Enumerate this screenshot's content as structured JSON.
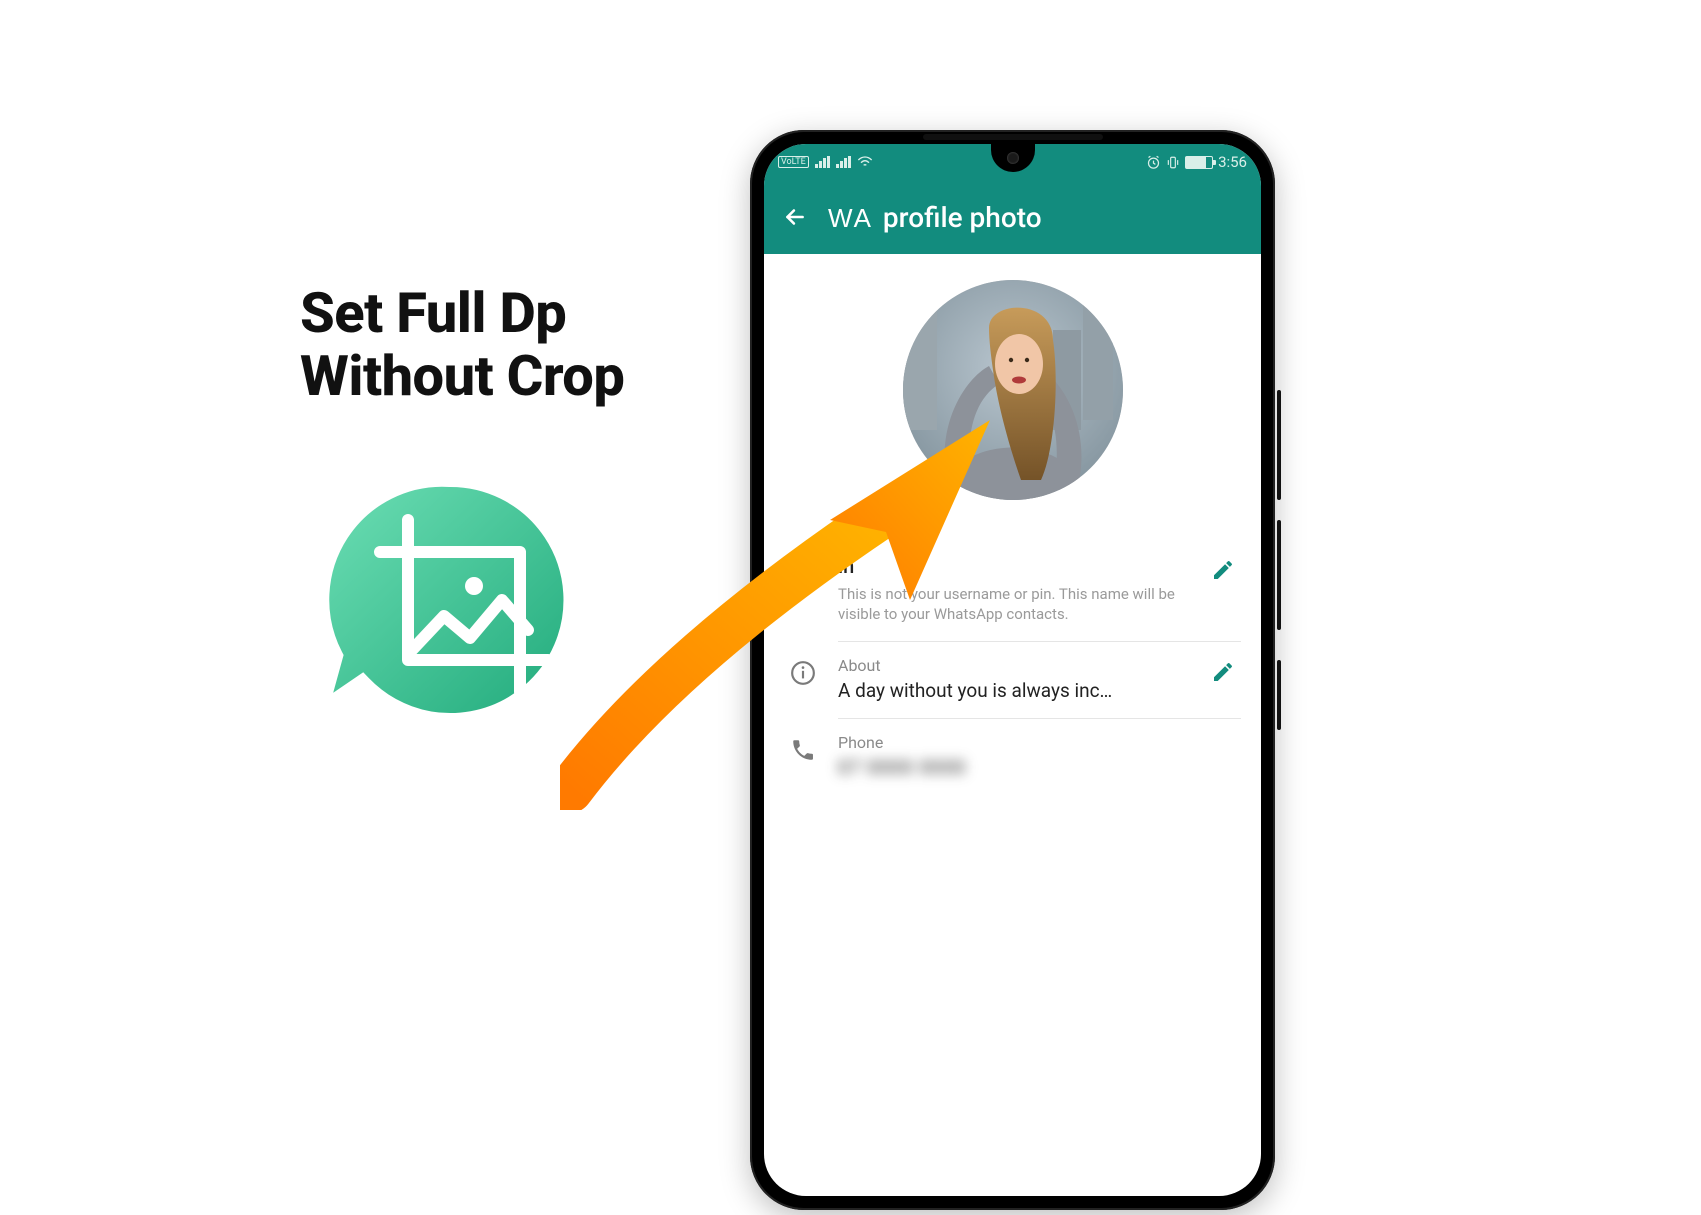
{
  "headline": {
    "line1": "Set Full Dp",
    "line2": "Without Crop"
  },
  "statusbar": {
    "carrier_badge": "VoLTE",
    "time": "3:56"
  },
  "appbar": {
    "wa": "WA",
    "title": "profile photo"
  },
  "name_row": {
    "visible_fragment": "in",
    "hint": "This is not your username or pin. This name will be visible to your WhatsApp contacts."
  },
  "about_row": {
    "label": "About",
    "value": "A day without you is always inc…"
  },
  "phone_row": {
    "label": "Phone",
    "value_blurred": "07 0000 0000"
  },
  "icons": {
    "back": "back-arrow-icon",
    "info": "info-icon",
    "phone": "phone-icon",
    "edit": "pencil-icon"
  }
}
